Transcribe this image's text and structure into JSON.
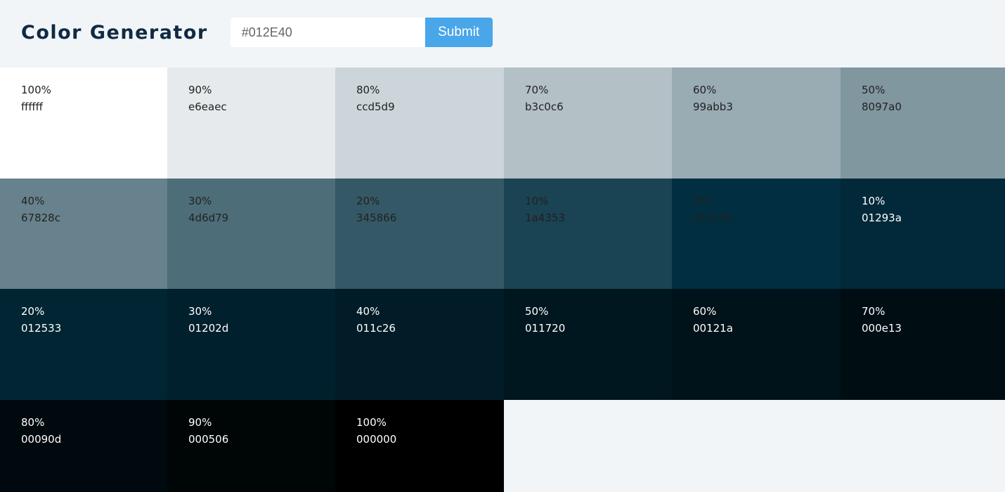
{
  "header": {
    "title": "Color Generator",
    "input_value": "",
    "input_placeholder": "#012E40",
    "submit_label": "Submit"
  },
  "colors": [
    {
      "percent": "100%",
      "hex": "ffffff",
      "bg": "#ffffff",
      "text": "#222222"
    },
    {
      "percent": "90%",
      "hex": "e6eaec",
      "bg": "#e6eaec",
      "text": "#222222"
    },
    {
      "percent": "80%",
      "hex": "ccd5d9",
      "bg": "#ccd5d9",
      "text": "#222222"
    },
    {
      "percent": "70%",
      "hex": "b3c0c6",
      "bg": "#b3c0c6",
      "text": "#222222"
    },
    {
      "percent": "60%",
      "hex": "99abb3",
      "bg": "#99abb3",
      "text": "#222222"
    },
    {
      "percent": "50%",
      "hex": "8097a0",
      "bg": "#8097a0",
      "text": "#222222"
    },
    {
      "percent": "40%",
      "hex": "67828c",
      "bg": "#67828c",
      "text": "#222222"
    },
    {
      "percent": "30%",
      "hex": "4d6d79",
      "bg": "#4d6d79",
      "text": "#222222"
    },
    {
      "percent": "20%",
      "hex": "345866",
      "bg": "#345866",
      "text": "#222222"
    },
    {
      "percent": "10%",
      "hex": "1a4353",
      "bg": "#1a4353",
      "text": "#222222"
    },
    {
      "percent": "0%",
      "hex": "012e40",
      "bg": "#012e40",
      "text": "#222222"
    },
    {
      "percent": "10%",
      "hex": "01293a",
      "bg": "#01293a",
      "text": "#ffffff"
    },
    {
      "percent": "20%",
      "hex": "012533",
      "bg": "#012533",
      "text": "#ffffff"
    },
    {
      "percent": "30%",
      "hex": "01202d",
      "bg": "#01202d",
      "text": "#ffffff"
    },
    {
      "percent": "40%",
      "hex": "011c26",
      "bg": "#011c26",
      "text": "#ffffff"
    },
    {
      "percent": "50%",
      "hex": "011720",
      "bg": "#011720",
      "text": "#ffffff"
    },
    {
      "percent": "60%",
      "hex": "00121a",
      "bg": "#00121a",
      "text": "#ffffff"
    },
    {
      "percent": "70%",
      "hex": "000e13",
      "bg": "#000e13",
      "text": "#ffffff"
    },
    {
      "percent": "80%",
      "hex": "00090d",
      "bg": "#00090d",
      "text": "#ffffff"
    },
    {
      "percent": "90%",
      "hex": "000506",
      "bg": "#000506",
      "text": "#ffffff"
    },
    {
      "percent": "100%",
      "hex": "000000",
      "bg": "#000000",
      "text": "#ffffff"
    }
  ]
}
